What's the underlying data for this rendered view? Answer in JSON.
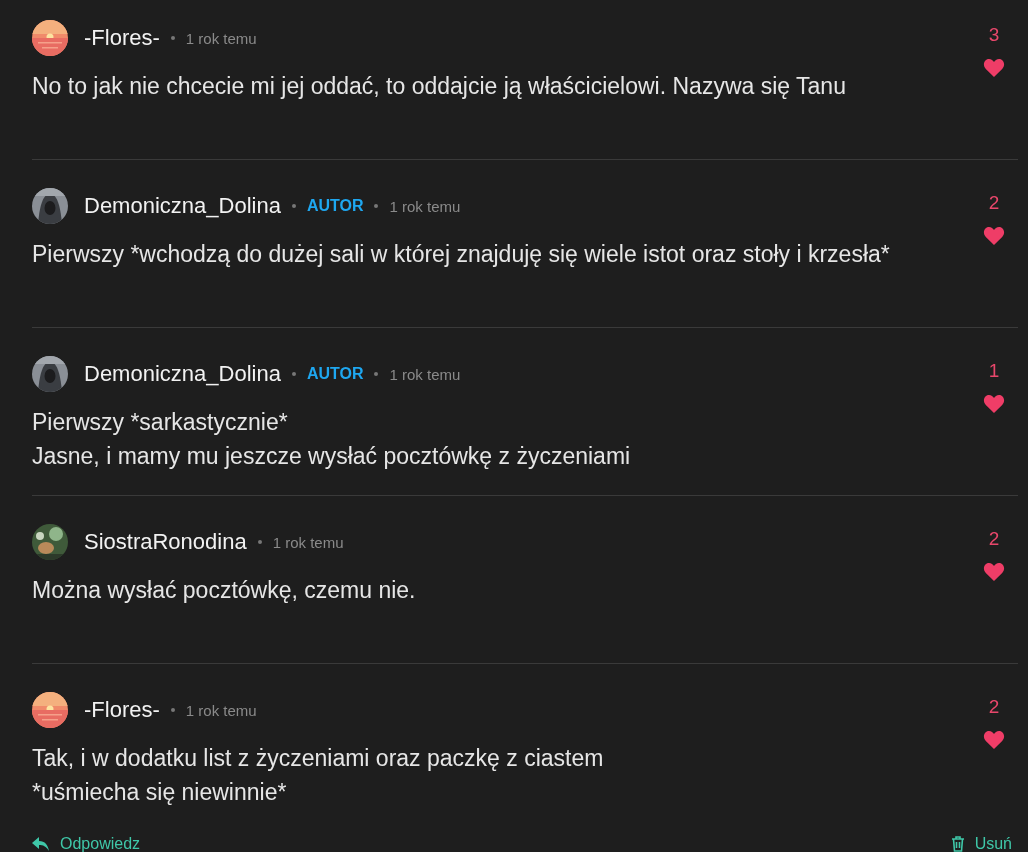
{
  "comments": [
    {
      "avatar": {
        "kind": "picture"
      },
      "author": "-Flores-",
      "time": "1 rok temu",
      "text": [
        "No to jak nie chcecie mi jej oddać, to oddajcie ją właścicielowi. Nazywa się Tanu"
      ],
      "likes": "3"
    },
    {
      "avatar": {
        "kind": "picture"
      },
      "author": "Demoniczna_Dolina",
      "badge": "AUTOR",
      "time": "1 rok temu",
      "text": [
        "Pierwszy *wchodzą do dużej sali w której znajduję się wiele istot oraz stoły i krzesła*"
      ],
      "likes": "2"
    },
    {
      "avatar": {
        "kind": "picture"
      },
      "author": "Demoniczna_Dolina",
      "badge": "AUTOR",
      "time": "1 rok temu",
      "text": [
        "Pierwszy *sarkastycznie*",
        "Jasne, i mamy mu jeszcze wysłać pocztówkę z życzeniami"
      ],
      "likes": "1"
    },
    {
      "avatar": {
        "kind": "picture"
      },
      "author": "SiostraRonodina",
      "time": "1 rok temu",
      "text": [
        "Można wysłać pocztówkę, czemu nie."
      ],
      "likes": "2"
    },
    {
      "avatar": {
        "kind": "picture"
      },
      "author": "-Flores-",
      "time": "1 rok temu",
      "text": [
        "Tak, i w dodatku list z życzeniami oraz paczkę z ciastem",
        "*uśmiecha się niewinnie*"
      ],
      "likes": "2"
    }
  ],
  "footer": {
    "reply": "Odpowiedz",
    "delete": "Usuń"
  }
}
